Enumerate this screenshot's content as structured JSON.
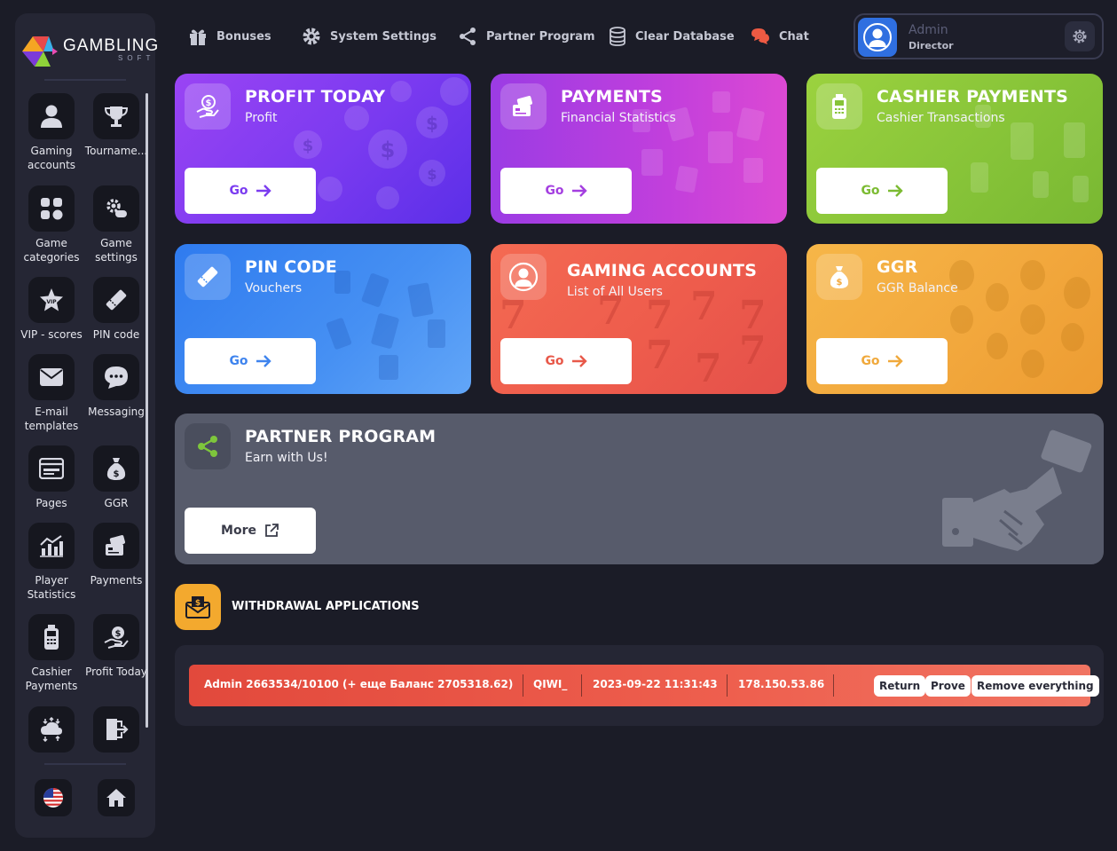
{
  "brand": {
    "name": "GAMBLING",
    "sub": "SOFT"
  },
  "sidebar": {
    "items": [
      {
        "label": "Gaming accounts",
        "icon": "user-icon"
      },
      {
        "label": "Tourname...",
        "icon": "trophy-icon"
      },
      {
        "label": "Game categories",
        "icon": "grid-icon"
      },
      {
        "label": "Game settings",
        "icon": "gamepad-gear-icon"
      },
      {
        "label": "VIP - scores",
        "icon": "vip-star-icon"
      },
      {
        "label": "PIN code",
        "icon": "ticket-icon"
      },
      {
        "label": "E-mail templates",
        "icon": "envelope-icon"
      },
      {
        "label": "Messaging",
        "icon": "chat-bubble-icon"
      },
      {
        "label": "Pages",
        "icon": "browser-window-icon"
      },
      {
        "label": "GGR",
        "icon": "money-bag-icon"
      },
      {
        "label": "Player Statistics",
        "icon": "bar-chart-icon"
      },
      {
        "label": "Payments",
        "icon": "card-in-hand-icon"
      },
      {
        "label": "Cashier Payments",
        "icon": "pos-terminal-icon"
      },
      {
        "label": "Profit Today",
        "icon": "hand-coin-icon"
      },
      {
        "label": "",
        "icon": "cloud-transfer-icon"
      },
      {
        "label": "",
        "icon": "logout-icon"
      }
    ],
    "bottom": [
      {
        "icon": "us-flag-icon"
      },
      {
        "icon": "home-icon"
      }
    ]
  },
  "topnav": {
    "items": [
      {
        "label": "Bonuses",
        "icon": "gift-icon"
      },
      {
        "label": "System Settings",
        "icon": "gear-icon"
      },
      {
        "label": "Partner Program",
        "icon": "share-icon"
      },
      {
        "label": "Clear Database",
        "icon": "database-icon"
      },
      {
        "label": "Chat",
        "icon": "chat-icon"
      }
    ]
  },
  "user": {
    "name": "Admin",
    "role": "Director"
  },
  "cards": [
    {
      "title": "PROFIT TODAY",
      "subtitle": "Profit",
      "button": "Go",
      "color": "#7b3cf0"
    },
    {
      "title": "PAYMENTS",
      "subtitle": "Financial Statistics",
      "button": "Go",
      "color": "#b23fe0"
    },
    {
      "title": "CASHIER PAYMENTS",
      "subtitle": "Cashier Transactions",
      "button": "Go",
      "color": "#8bc43a"
    },
    {
      "title": "PIN CODE",
      "subtitle": "Vouchers",
      "button": "Go",
      "color": "#3f8cf2"
    },
    {
      "title": "GAMING ACCOUNTS",
      "subtitle": "List of All Users",
      "button": "Go",
      "color": "#ee5c4c"
    },
    {
      "title": "GGR",
      "subtitle": "GGR Balance",
      "button": "Go",
      "color": "#f3a93c"
    }
  ],
  "partner": {
    "title": "PARTNER PROGRAM",
    "subtitle": "Earn with Us!",
    "button": "More"
  },
  "withdrawals": {
    "title": "WITHDRAWAL APPLICATIONS",
    "rows": [
      {
        "user": "Admin 2663534/10100 (+ еще Баланс 2705318.62)",
        "method": "QIWI_",
        "datetime": "2023-09-22 11:31:43",
        "ip": "178.150.53.86",
        "actions": [
          "Return",
          "Prove",
          "Remove everything"
        ]
      }
    ]
  }
}
